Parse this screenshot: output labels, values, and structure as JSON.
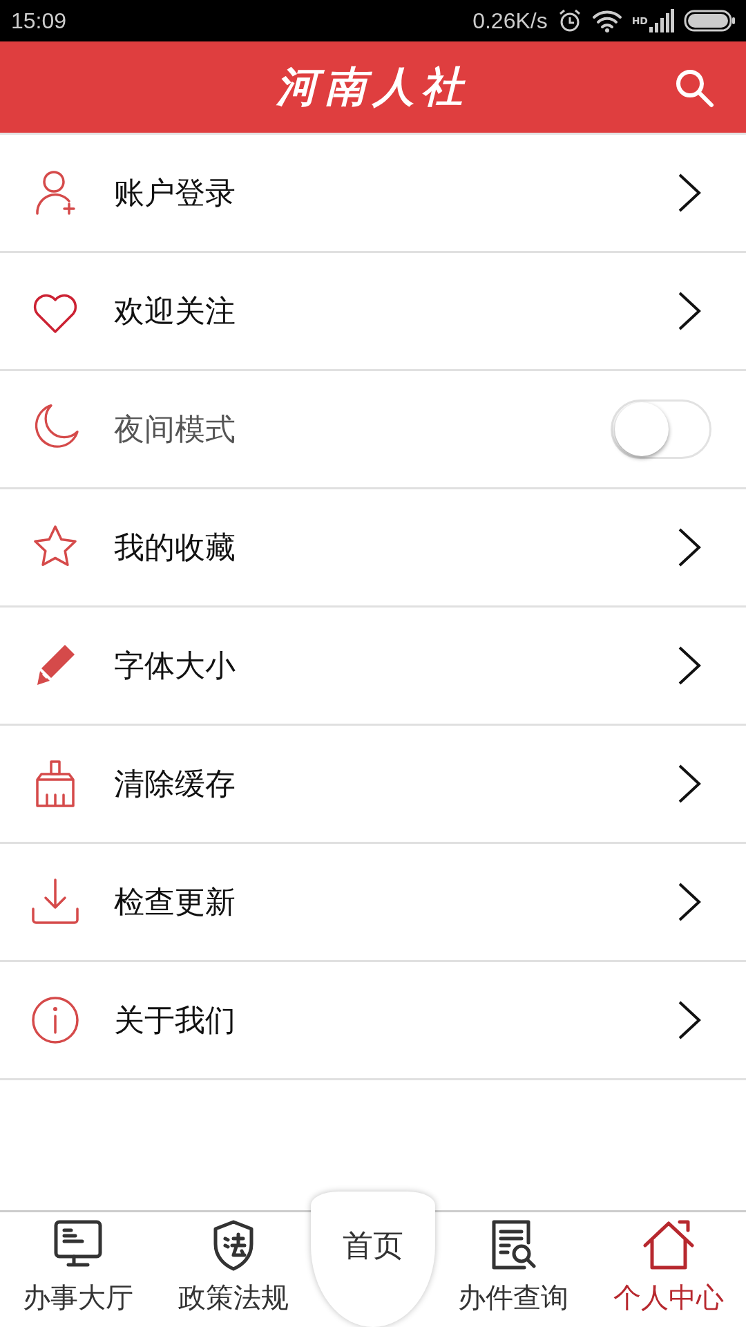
{
  "status_bar": {
    "time": "15:09",
    "speed": "0.26K/s",
    "network": "HD"
  },
  "header": {
    "title": "河南人社"
  },
  "menu": [
    {
      "label": "账户登录",
      "kind": "link"
    },
    {
      "label": "欢迎关注",
      "kind": "link"
    },
    {
      "label": "夜间模式",
      "kind": "toggle",
      "on": false
    },
    {
      "label": "我的收藏",
      "kind": "link"
    },
    {
      "label": "字体大小",
      "kind": "link"
    },
    {
      "label": "清除缓存",
      "kind": "link"
    },
    {
      "label": "检查更新",
      "kind": "link"
    },
    {
      "label": "关于我们",
      "kind": "link"
    }
  ],
  "bottom_nav": [
    {
      "label": "办事大厅",
      "kind": "tab",
      "selected": false
    },
    {
      "label": "政策法规",
      "kind": "tab",
      "selected": false
    },
    {
      "label": "首页",
      "kind": "home",
      "selected": false
    },
    {
      "label": "办件查询",
      "kind": "tab",
      "selected": false
    },
    {
      "label": "个人中心",
      "kind": "tab",
      "selected": true
    }
  ]
}
